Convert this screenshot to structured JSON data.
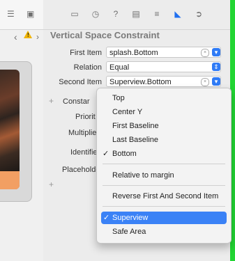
{
  "inspector": {
    "title": "Vertical Space Constraint",
    "first_item_label": "First Item",
    "first_item_value": "splash.Bottom",
    "relation_label": "Relation",
    "relation_value": "Equal",
    "second_item_label": "Second Item",
    "second_item_value": "Superview.Bottom",
    "constant_label": "Constar",
    "priority_label": "Priorit",
    "multiplier_label": "Multiplie",
    "identifier_label": "Identifie",
    "placeholder_label": "Placeholde"
  },
  "menu": {
    "items": [
      {
        "label": "Top",
        "checked": false
      },
      {
        "label": "Center Y",
        "checked": false
      },
      {
        "label": "First Baseline",
        "checked": false
      },
      {
        "label": "Last Baseline",
        "checked": false
      },
      {
        "label": "Bottom",
        "checked": true
      },
      {
        "label": "Relative to margin",
        "checked": false
      },
      {
        "label": "Reverse First And Second Item",
        "checked": false
      },
      {
        "label": "Superview",
        "checked": true
      },
      {
        "label": "Safe Area",
        "checked": false
      }
    ]
  },
  "toolbar": {
    "icons": [
      "file-icon",
      "clock-icon",
      "help-icon",
      "identity-icon",
      "attributes-icon",
      "size-icon",
      "connections-icon"
    ]
  },
  "colors": {
    "accent": "#3b82f6",
    "warning": "#f0b400",
    "edge": "#22d533"
  }
}
